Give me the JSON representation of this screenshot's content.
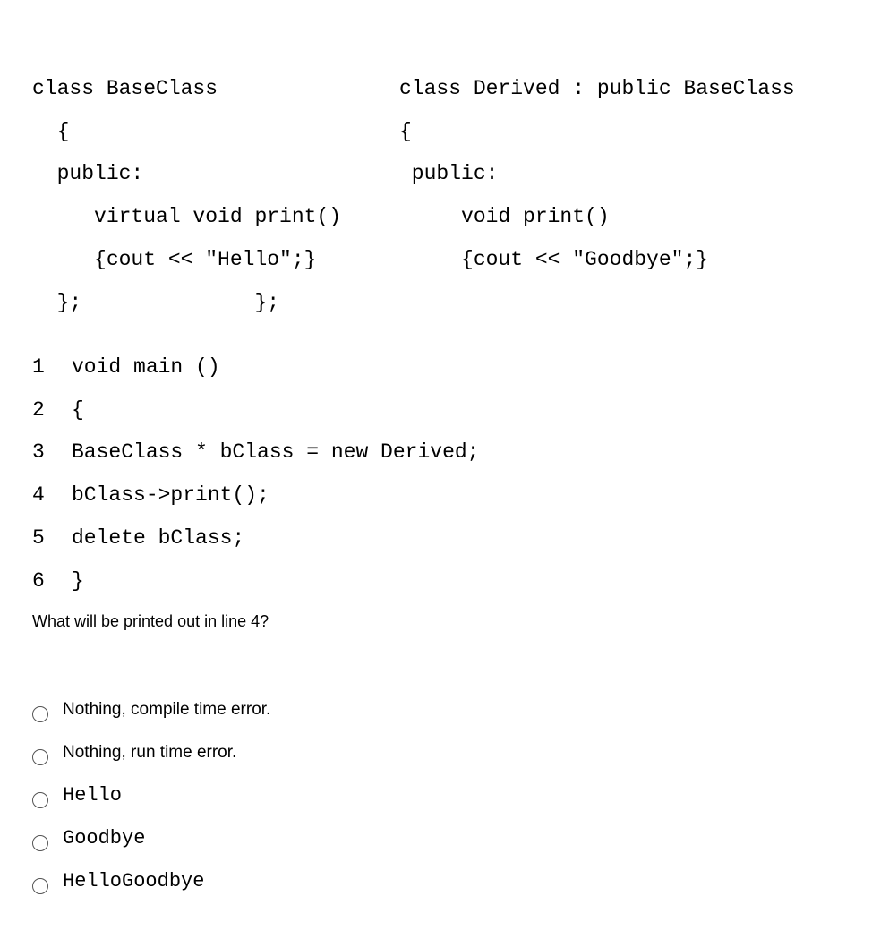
{
  "code_left": {
    "l1": "class BaseClass",
    "l2": "  {",
    "l3": "  public:",
    "l4": "     virtual void print()",
    "l5": "     {cout << \"Hello\";}",
    "l6": "  };              };"
  },
  "code_right": {
    "l1": "class Derived : public BaseClass",
    "l2": "{",
    "l3": " public:",
    "l4": "     void print()",
    "l5": "     {cout << \"Goodbye\";}",
    "l6": ""
  },
  "main_code": [
    {
      "num": "1",
      "text": " void main ()"
    },
    {
      "num": "2",
      "text": " {"
    },
    {
      "num": "3",
      "text": "    BaseClass * bClass = new Derived;"
    },
    {
      "num": "4",
      "text": "    bClass->print();"
    },
    {
      "num": "5",
      "text": "    delete bClass;"
    },
    {
      "num": "6",
      "text": " }"
    }
  ],
  "question": "What will be printed out in line 4?",
  "options": [
    {
      "label": "Nothing, compile time error.",
      "font": "sans"
    },
    {
      "label": "Nothing, run time error.",
      "font": "sans"
    },
    {
      "label": "Hello",
      "font": "mono"
    },
    {
      "label": "Goodbye",
      "font": "mono"
    },
    {
      "label": "HelloGoodbye",
      "font": "mono"
    }
  ]
}
